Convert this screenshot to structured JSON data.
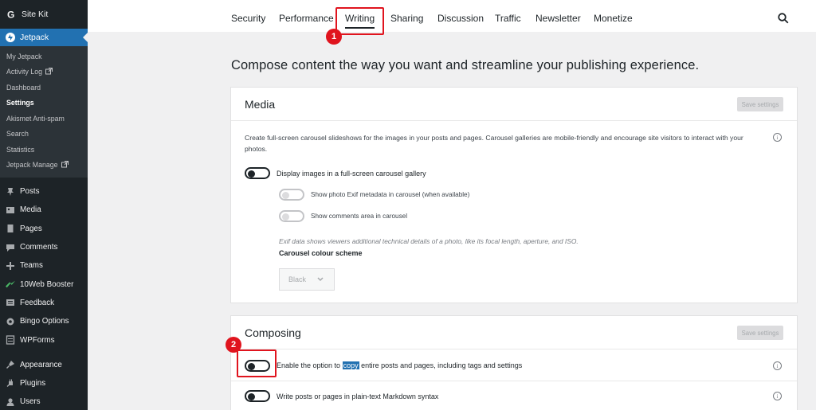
{
  "sidebar": {
    "site_kit": "Site Kit",
    "jetpack": "Jetpack",
    "sub": [
      {
        "label": "My Jetpack",
        "external": false,
        "current": false
      },
      {
        "label": "Activity Log",
        "external": true,
        "current": false
      },
      {
        "label": "Dashboard",
        "external": false,
        "current": false
      },
      {
        "label": "Settings",
        "external": false,
        "current": true
      },
      {
        "label": "Akismet Anti-spam",
        "external": false,
        "current": false
      },
      {
        "label": "Search",
        "external": false,
        "current": false
      },
      {
        "label": "Statistics",
        "external": false,
        "current": false
      },
      {
        "label": "Jetpack Manage",
        "external": true,
        "current": false
      }
    ],
    "menu": [
      {
        "label": "Posts",
        "icon": "pin-icon"
      },
      {
        "label": "Media",
        "icon": "media-icon"
      },
      {
        "label": "Pages",
        "icon": "pages-icon"
      },
      {
        "label": "Comments",
        "icon": "comments-icon"
      },
      {
        "label": "Teams",
        "icon": "plus-icon"
      },
      {
        "label": "10Web Booster",
        "icon": "booster-icon"
      },
      {
        "label": "Feedback",
        "icon": "feedback-icon"
      },
      {
        "label": "Bingo Options",
        "icon": "gear-icon"
      },
      {
        "label": "WPForms",
        "icon": "forms-icon"
      }
    ],
    "menu2": [
      {
        "label": "Appearance",
        "icon": "brush-icon"
      },
      {
        "label": "Plugins",
        "icon": "plug-icon"
      },
      {
        "label": "Users",
        "icon": "user-icon"
      }
    ]
  },
  "tabs": [
    "Security",
    "Performance",
    "Writing",
    "Sharing",
    "Discussion",
    "Traffic",
    "Newsletter",
    "Monetize"
  ],
  "active_tab": "Writing",
  "headline": "Compose content the way you want and streamline your publishing experience.",
  "media": {
    "title": "Media",
    "save_label": "Save settings",
    "description": "Create full-screen carousel slideshows for the images in your posts and pages. Carousel galleries are mobile-friendly and encourage site visitors to interact with your photos.",
    "toggle_main": "Display images in a full-screen carousel gallery",
    "toggle_exif": "Show photo Exif metadata in carousel (when available)",
    "toggle_comments": "Show comments area in carousel",
    "exif_note": "Exif data shows viewers additional technical details of a photo, like its focal length, aperture, and ISO.",
    "scheme_label": "Carousel colour scheme",
    "scheme_value": "Black"
  },
  "composing": {
    "title": "Composing",
    "save_label": "Save settings",
    "copy_before": "Enable the option to ",
    "copy_word": "copy",
    "copy_after": " entire posts and pages, including tags and settings",
    "markdown": "Write posts or pages in plain-text Markdown syntax"
  },
  "annotations": {
    "one": "1",
    "two": "2"
  },
  "colors": {
    "accent": "#2271b1",
    "highlight": "#e0141e",
    "sidebar": "#1d2327"
  }
}
